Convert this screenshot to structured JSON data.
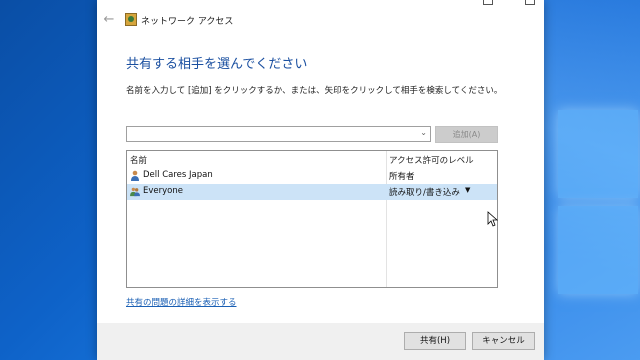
{
  "window": {
    "title": "ネットワーク アクセス",
    "back_icon": "←"
  },
  "heading": "共有する相手を選んでください",
  "instruction": "名前を入力して [追加] をクリックするか、または、矢印をクリックして相手を検索してください。",
  "combo": {
    "value": "",
    "arrow": "⌄"
  },
  "add_button": "追加(A)",
  "table": {
    "headers": [
      "名前",
      "アクセス許可のレベル"
    ],
    "rows": [
      {
        "name": "Dell Cares Japan",
        "permission": "所有者",
        "selected": false,
        "icon": "user-icon"
      },
      {
        "name": "Everyone",
        "permission": "読み取り/書き込み",
        "selected": true,
        "icon": "group-icon",
        "dropdown": "▼"
      }
    ]
  },
  "help_link": "共有の問題の詳細を表示する",
  "footer": {
    "share_button": "共有(H)",
    "cancel_button": "キャンセル"
  },
  "colors": {
    "heading": "#1a4fa0",
    "selection": "#cce3f7",
    "link": "#1a5fb4"
  }
}
